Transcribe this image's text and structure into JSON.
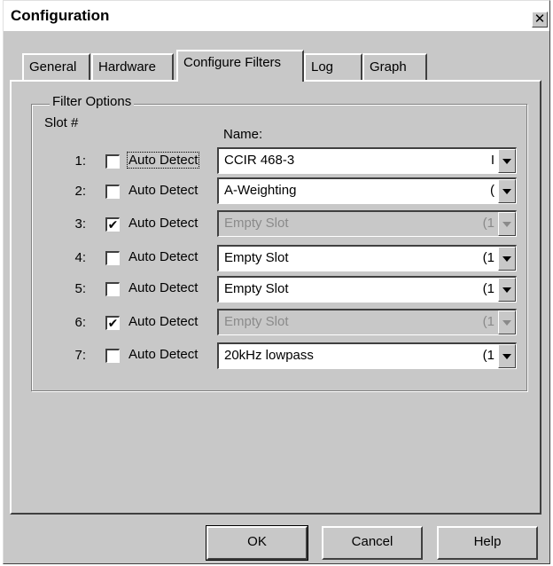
{
  "window": {
    "title": "Configuration",
    "close_symbol": "✕"
  },
  "tabs": [
    {
      "label": "General",
      "active": false
    },
    {
      "label": "Hardware",
      "active": false
    },
    {
      "label": "Configure Filters",
      "active": true
    },
    {
      "label": "Log",
      "active": false
    },
    {
      "label": "Graph",
      "active": false
    }
  ],
  "group": {
    "title": "Filter Options",
    "slot_header": "Slot #",
    "name_header": "Name:"
  },
  "rows": [
    {
      "num": "1:",
      "checked": false,
      "auto_label": "Auto Detect",
      "name": "CCIR 468-3",
      "tail": "I",
      "enabled": true
    },
    {
      "num": "2:",
      "checked": false,
      "auto_label": "Auto Detect",
      "name": "A-Weighting",
      "tail": "(",
      "enabled": true
    },
    {
      "num": "3:",
      "checked": true,
      "auto_label": "Auto Detect",
      "name": "Empty Slot",
      "tail": "(1",
      "enabled": false
    },
    {
      "num": "4:",
      "checked": false,
      "auto_label": "Auto Detect",
      "name": "Empty Slot",
      "tail": "(1",
      "enabled": true
    },
    {
      "num": "5:",
      "checked": false,
      "auto_label": "Auto Detect",
      "name": "Empty Slot",
      "tail": "(1",
      "enabled": true
    },
    {
      "num": "6:",
      "checked": true,
      "auto_label": "Auto Detect",
      "name": "Empty Slot",
      "tail": "(1",
      "enabled": false
    },
    {
      "num": "7:",
      "checked": false,
      "auto_label": "Auto Detect",
      "name": "20kHz lowpass",
      "tail": "(1",
      "enabled": true
    }
  ],
  "buttons": {
    "ok": "OK",
    "cancel": "Cancel",
    "help": "Help"
  },
  "check_glyph": "✔"
}
